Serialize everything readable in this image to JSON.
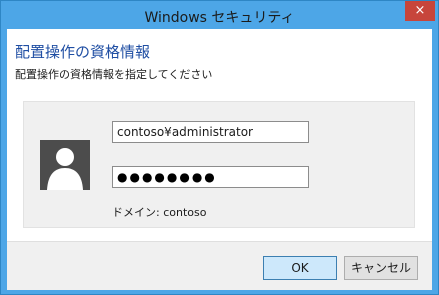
{
  "window": {
    "title": "Windows セキュリティ",
    "close_glyph": "×"
  },
  "dialog": {
    "heading": "配置操作の資格情報",
    "subheading": "配置操作の資格情報を指定してください"
  },
  "credentials": {
    "username": "contoso¥administrator",
    "password_mask": "●●●●●●●●",
    "domain_label": "ドメイン: contoso"
  },
  "buttons": {
    "ok": "OK",
    "cancel": "キャンセル"
  },
  "colors": {
    "title_bar": "#4da6e7",
    "close_button": "#c7453b",
    "heading": "#1f4ea3"
  },
  "icons": {
    "avatar": "user-silhouette-icon"
  }
}
